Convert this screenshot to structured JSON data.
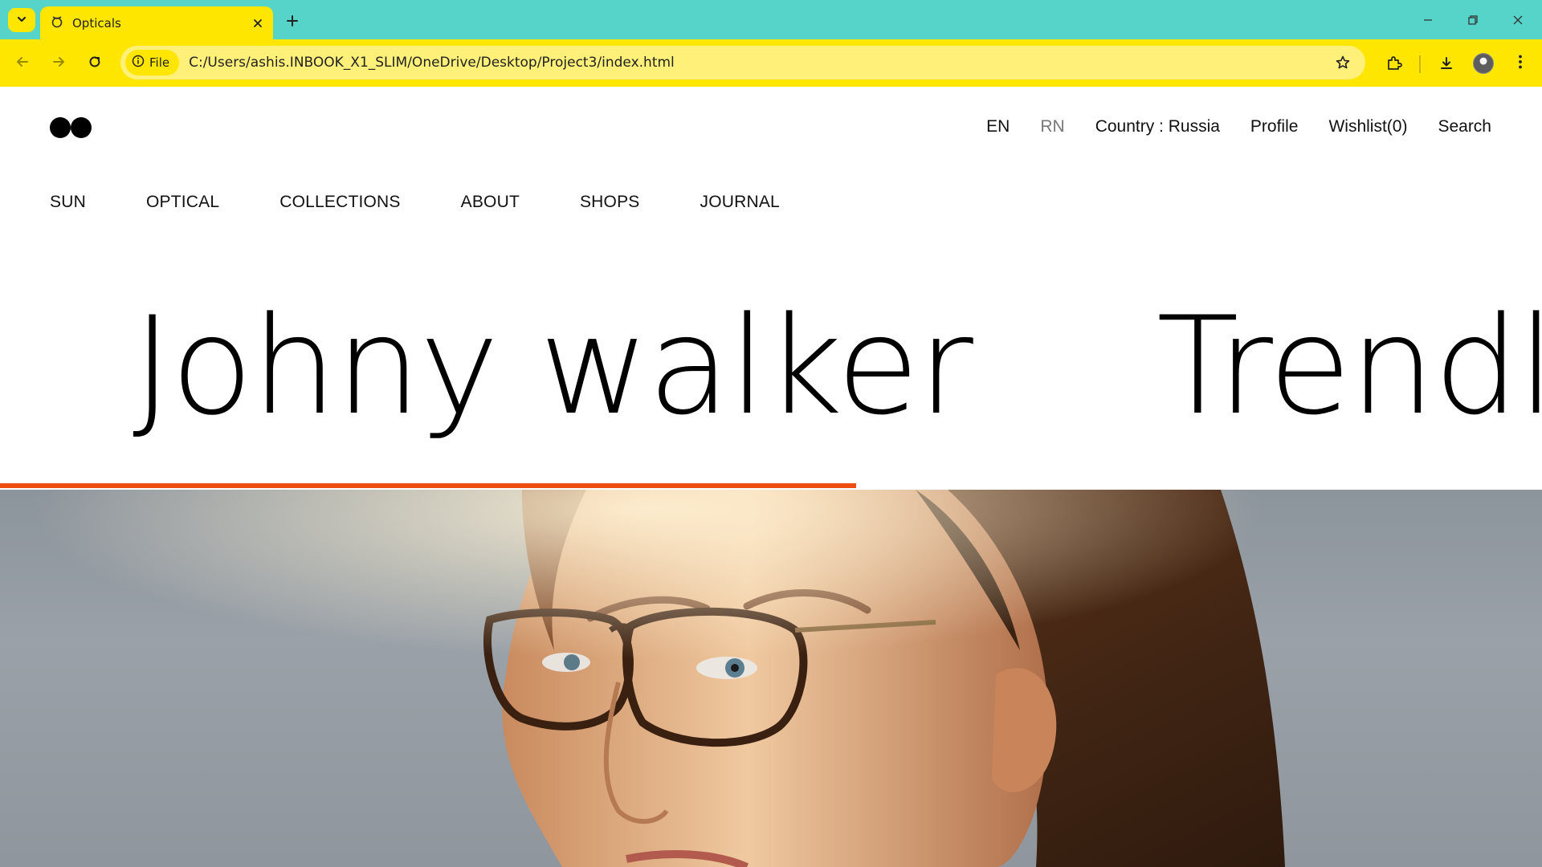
{
  "browser": {
    "tab_title": "Opticals",
    "site_chip": "File",
    "url": "C:/Users/ashis.INBOOK_X1_SLIM/OneDrive/Desktop/Project3/index.html",
    "colors": {
      "tabstrip": "#56d4c9",
      "toolbar": "#ffe600",
      "omnibox": "#fff07a"
    }
  },
  "header": {
    "lang_en": "EN",
    "lang_rn": "RN",
    "country": "Country : Russia",
    "profile": "Profile",
    "wishlist": "Wishlist(0)",
    "search": "Search"
  },
  "nav": {
    "items": [
      {
        "label": "SUN"
      },
      {
        "label": "OPTICAL"
      },
      {
        "label": "COLLECTIONS"
      },
      {
        "label": "ABOUT"
      },
      {
        "label": "SHOPS"
      },
      {
        "label": "JOURNAL"
      }
    ]
  },
  "hero": {
    "slides": [
      {
        "title": "Johny walker"
      },
      {
        "title": "Trendlin"
      }
    ],
    "progress": 0.555,
    "accent": "#ee4d12",
    "image": "woman-with-glasses-photo"
  }
}
